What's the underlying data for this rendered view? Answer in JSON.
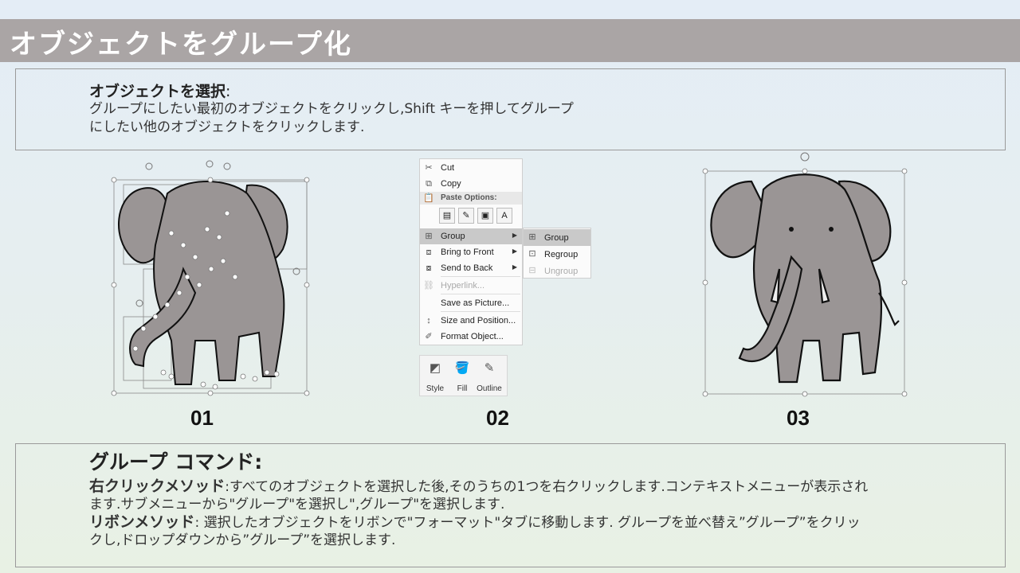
{
  "slide": {
    "title": "オブジェクトをグループ化"
  },
  "section1": {
    "heading": "オブジェクトを選択",
    "heading_colon": ":",
    "body": "グループにしたい最初のオブジェクトをクリックし,Shift キーを押してグループにしたい他のオブジェクトをクリックします."
  },
  "steps": [
    {
      "label": "01"
    },
    {
      "label": "02"
    },
    {
      "label": "03"
    }
  ],
  "context_menu": {
    "items": [
      {
        "label": "Cut",
        "icon": "scissors-icon"
      },
      {
        "label": "Copy",
        "icon": "copy-icon"
      },
      {
        "label": "Paste Options:",
        "icon": "paste-icon"
      },
      {
        "label": "Group",
        "icon": "group-icon"
      },
      {
        "label": "Bring to Front",
        "icon": "bring-front-icon"
      },
      {
        "label": "Send to Back",
        "icon": "send-back-icon"
      },
      {
        "label": "Hyperlink...",
        "icon": "hyperlink-icon"
      },
      {
        "label": "Save as Picture...",
        "icon": ""
      },
      {
        "label": "Size and Position...",
        "icon": "size-icon"
      },
      {
        "label": "Format Object...",
        "icon": "format-icon"
      }
    ],
    "submenu": [
      {
        "label": "Group"
      },
      {
        "label": "Regroup"
      },
      {
        "label": "Ungroup"
      }
    ]
  },
  "ribbon": {
    "buttons": [
      {
        "label": "Style"
      },
      {
        "label": "Fill"
      },
      {
        "label": "Outline"
      }
    ]
  },
  "section2": {
    "heading": "グループ コマンド:",
    "right_click_label": "右クリックメソッド",
    "right_click_text": ":すべてのオブジェクトを選択した後,そのうちの1つを右クリックします.コンテキストメニューが表示されます.サブメニューから\"グループ\"を選択し\",グループ\"を選択します.",
    "ribbon_label": "リボンメソッド",
    "ribbon_text": ": 選択したオブジェクトをリボンで\"フォーマット\"タブに移動します. グループを並べ替え”グループ”をクリックし,ドロップダウンから”グループ”を選択します."
  },
  "colors": {
    "title_bar": "#aaa5a5",
    "elephant_fill": "#9a9595",
    "menu_highlight": "#c9c9c9"
  }
}
